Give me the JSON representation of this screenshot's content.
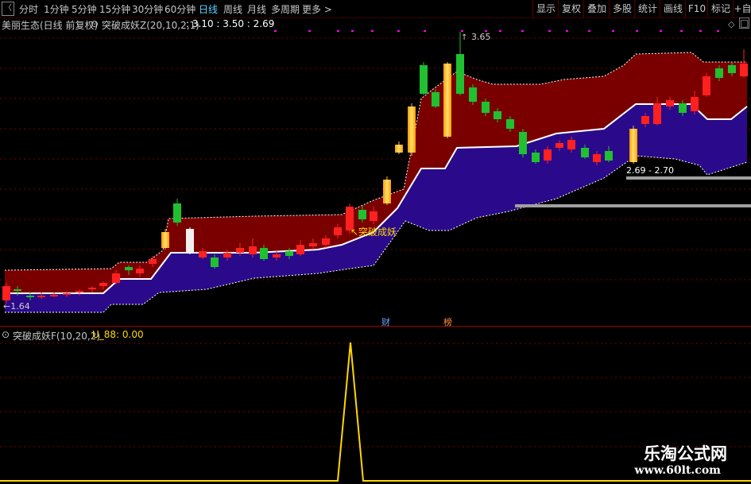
{
  "toolbar": {
    "back": "〈",
    "periods": [
      "分时",
      "1分钟",
      "5分钟",
      "15分钟",
      "30分钟",
      "60分钟",
      "日线",
      "周线",
      "月线",
      "多周期",
      "更多 >"
    ],
    "active": "日线",
    "right": [
      "显示",
      "复权",
      "叠加",
      "多股",
      "统计",
      "画线",
      "F10",
      "标记",
      "+自"
    ]
  },
  "main": {
    "stock": "美丽生态(日线 前复权)",
    "indicator": "突破成妖Z(20,10,2,1)",
    "values": ": 3.10 : 3.50 : 2.69",
    "high_label": "3.65",
    "low_label": "←1.64",
    "signal_label": "↖突破成妖",
    "range_label": "2.69 - 2.70",
    "event_1": "财",
    "event_2": "榜"
  },
  "sub": {
    "indicator": "突破成妖F(10,20,2)",
    "value_text": "U_88: 0.00"
  },
  "watermark": {
    "name": "乐淘公式网",
    "url": "www.60lt.com"
  },
  "colors": {
    "up": "#ff2020",
    "down": "#20c030",
    "upper_band": "#7a0000",
    "lower_band": "#2a0a8a",
    "signal": "#ffd700",
    "line": "#ffffff"
  }
}
